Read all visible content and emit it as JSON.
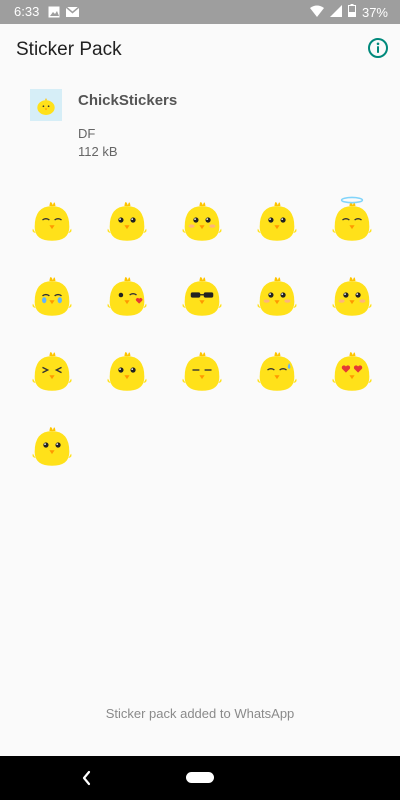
{
  "status_bar": {
    "time": "6:33",
    "battery": "37%",
    "icons": [
      "image-icon",
      "gmail-icon",
      "wifi-icon",
      "signal-icon",
      "battery-icon"
    ]
  },
  "app_bar": {
    "title": "Sticker Pack",
    "info_icon": "info-icon"
  },
  "pack": {
    "name": "ChickStickers",
    "publisher": "DF",
    "size": "112 kB"
  },
  "stickers": [
    "chick-squint",
    "chick-happy",
    "chick-blush",
    "chick-smile",
    "chick-halo",
    "chick-crying",
    "chick-kiss",
    "chick-sunglasses",
    "chick-shy",
    "chick-grin",
    "chick-laughing",
    "chick-content",
    "chick-sleepy",
    "chick-sweat",
    "chick-heart-eyes",
    "chick-wink"
  ],
  "footer": {
    "status": "Sticker pack added to WhatsApp"
  },
  "nav_bar": {
    "back_icon": "back-icon",
    "home_icon": "home-pill-icon"
  },
  "colors": {
    "status_bar": "#9e9e9e",
    "background": "#fafafa",
    "accent": "#00897b",
    "chick_yellow": "#ffe11a",
    "tray_bg": "#d6eef7"
  }
}
